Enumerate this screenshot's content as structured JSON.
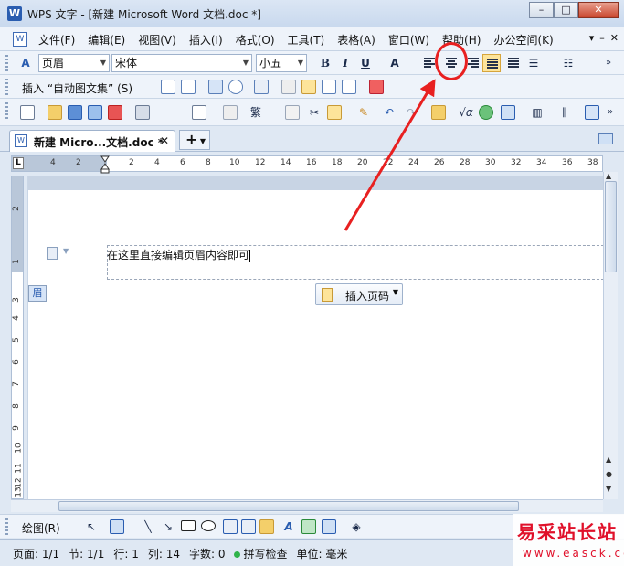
{
  "window": {
    "title": "WPS 文字 - [新建 Microsoft Word 文档.doc *]",
    "app_icon": "W",
    "controls": [
      "–",
      "□",
      "✕"
    ]
  },
  "menubar": {
    "items": [
      "文件(F)",
      "编辑(E)",
      "视图(V)",
      "插入(I)",
      "格式(O)",
      "工具(T)",
      "表格(A)",
      "窗口(W)",
      "帮助(H)",
      "办公空间(K)"
    ],
    "right_controls": [
      "▾",
      "–",
      "✕"
    ]
  },
  "format_toolbar": {
    "style_value": "页眉",
    "font_value": "宋体",
    "size_value": "小五",
    "bold": "B",
    "italic": "I",
    "underline": "U",
    "font_color": "A"
  },
  "insert_toolbar": {
    "label": "插入 “自动图文集” (S)"
  },
  "tabs": {
    "active_label": "新建 Micro...文档.doc *",
    "close": "✕",
    "new": "+"
  },
  "ruler": {
    "h_ticks": [
      "4",
      "2",
      "2",
      "4",
      "6",
      "8",
      "10",
      "12",
      "14",
      "16",
      "18",
      "20",
      "22",
      "24",
      "26",
      "28",
      "30",
      "32",
      "34",
      "36",
      "38"
    ],
    "v_ticks": [
      "2",
      "1",
      "3",
      "4",
      "5",
      "6",
      "7",
      "8",
      "9",
      "10",
      "11",
      "12",
      "13"
    ],
    "corner": "L"
  },
  "document": {
    "header_text": "在这里直接编辑页眉内容即可",
    "header_tag": "眉",
    "insert_page_number": "插入页码"
  },
  "draw_toolbar": {
    "label": "绘图(R)"
  },
  "status": {
    "page": "页面: 1/1",
    "section": "节: 1/1",
    "row": "行: 1",
    "col": "列: 14",
    "words": "字数: 0",
    "spell": "拼写检查",
    "unit": "单位: 毫米"
  },
  "watermark": {
    "title": "易采站长站",
    "url": "www.easck.com"
  },
  "colors": {
    "annotation_red": "#e82020",
    "active_button": "#fde49a",
    "watermark_red": "#e0102a"
  }
}
